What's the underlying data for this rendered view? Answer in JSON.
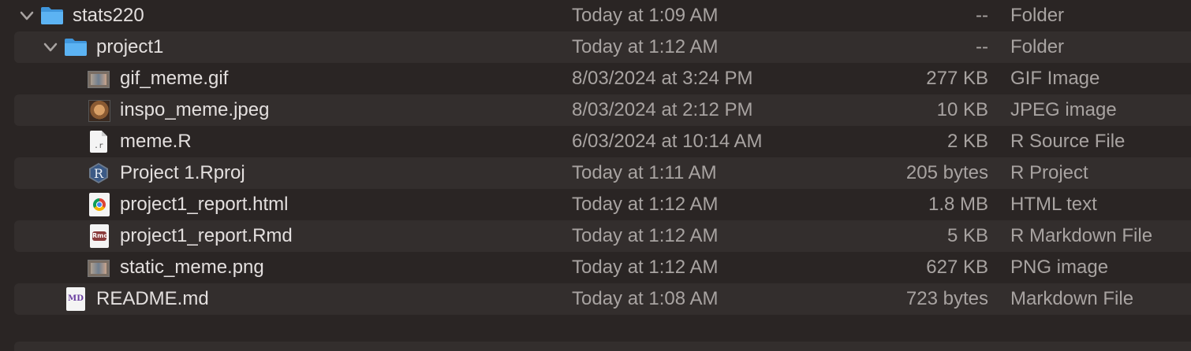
{
  "rows": [
    {
      "name": "stats220",
      "date": "Today at 1:09 AM",
      "size": "--",
      "kind": "Folder",
      "icon": "folder-icon"
    },
    {
      "name": "project1",
      "date": "Today at 1:12 AM",
      "size": "--",
      "kind": "Folder",
      "icon": "folder-icon"
    },
    {
      "name": "gif_meme.gif",
      "date": "8/03/2024 at 3:24 PM",
      "size": "277 KB",
      "kind": "GIF Image",
      "icon": "image-thumbnail-icon"
    },
    {
      "name": "inspo_meme.jpeg",
      "date": "8/03/2024 at 2:12 PM",
      "size": "10 KB",
      "kind": "JPEG image",
      "icon": "dog-thumbnail-icon"
    },
    {
      "name": "meme.R",
      "date": "6/03/2024 at 10:14 AM",
      "size": "2 KB",
      "kind": "R Source File",
      "icon": "r-source-file-icon",
      "icon_label": ".r"
    },
    {
      "name": "Project 1.Rproj",
      "date": "Today at 1:11 AM",
      "size": "205 bytes",
      "kind": "R Project",
      "icon": "r-project-icon"
    },
    {
      "name": "project1_report.html",
      "date": "Today at 1:12 AM",
      "size": "1.8 MB",
      "kind": "HTML text",
      "icon": "chrome-html-icon"
    },
    {
      "name": "project1_report.Rmd",
      "date": "Today at 1:12 AM",
      "size": "5 KB",
      "kind": "R Markdown File",
      "icon": "rmd-file-icon",
      "icon_label": "Rmd"
    },
    {
      "name": "static_meme.png",
      "date": "Today at 1:12 AM",
      "size": "627 KB",
      "kind": "PNG image",
      "icon": "image-thumbnail-icon"
    },
    {
      "name": "README.md",
      "date": "Today at 1:08 AM",
      "size": "723 bytes",
      "kind": "Markdown File",
      "icon": "markdown-file-icon",
      "icon_label": "MD"
    }
  ],
  "colors": {
    "background": "#2a2524",
    "row_alt": "#332e2d",
    "folder_blue": "#4fa9ef",
    "text": "#e3dfde",
    "secondary_text": "#a8a3a1"
  }
}
